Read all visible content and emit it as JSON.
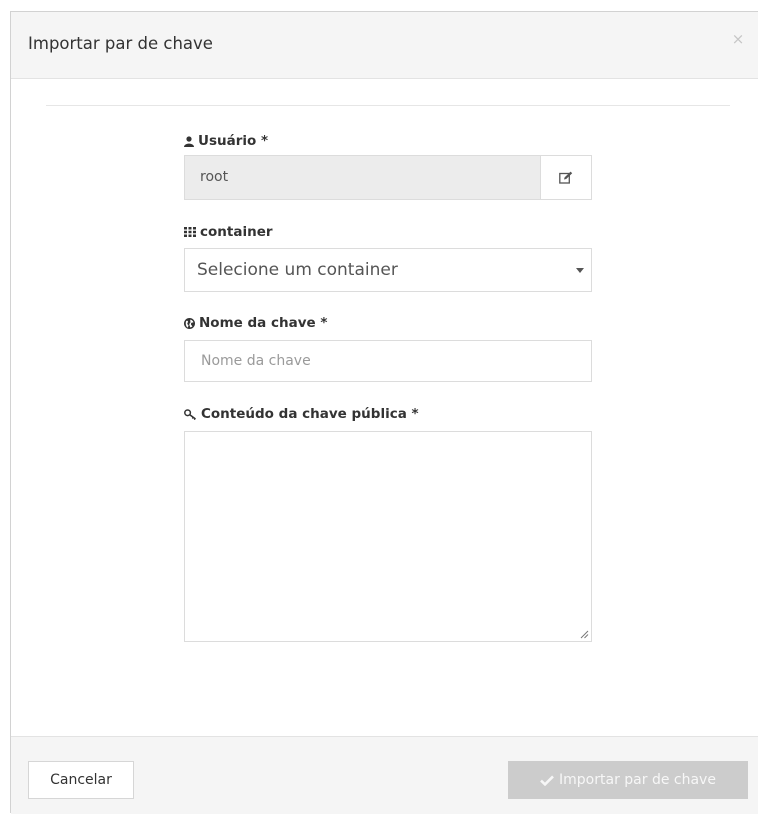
{
  "modal": {
    "title": "Importar par de chave",
    "close_symbol": "×"
  },
  "form": {
    "user": {
      "label": "Usuário *",
      "icon": "user-icon",
      "value": "root",
      "edit_icon": "edit-icon"
    },
    "container": {
      "label": "container",
      "icon": "grid-icon",
      "selected": "Selecione um container"
    },
    "key_name": {
      "label": "Nome da chave *",
      "icon": "globe-icon",
      "placeholder": "Nome da chave",
      "value": ""
    },
    "public_key": {
      "label": "Conteúdo da chave pública *",
      "icon": "key-icon",
      "value": ""
    }
  },
  "footer": {
    "cancel_label": "Cancelar",
    "import_label": "Importar par de chave",
    "import_icon": "check-icon"
  },
  "colors": {
    "header_bg": "#f5f5f5",
    "disabled_button": "#cccccc",
    "readonly_bg": "#ececec"
  }
}
